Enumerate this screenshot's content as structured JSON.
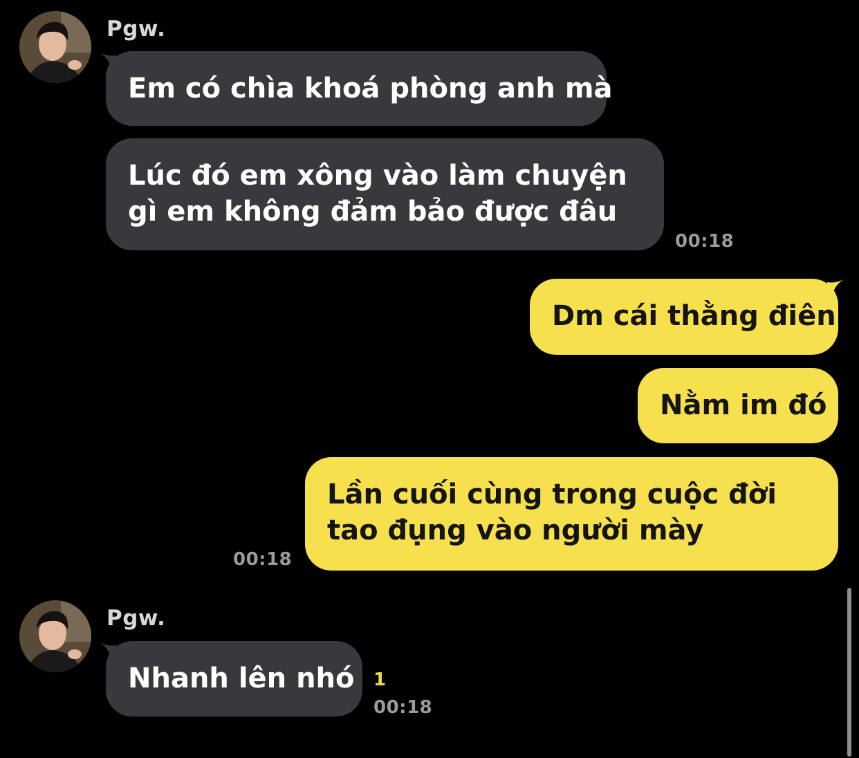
{
  "colors": {
    "background": "#000000",
    "incoming_bubble": "#39393d",
    "outgoing_bubble": "#f7e04e",
    "timestamp": "#9b9b9b",
    "unread": "#f2d94a"
  },
  "groups": [
    {
      "sender": "Pgw.",
      "avatar": "profile-photo",
      "messages": [
        "Em có chìa khoá phòng anh mà",
        "Lúc đó em xông vào làm chuyện gì em không đảm bảo được đâu"
      ],
      "time": "00:18"
    },
    {
      "sender": "me",
      "messages": [
        "Dm cái thằng điên",
        "Nằm im đó",
        "Lần cuối cùng trong cuộc đời tao đụng vào người mày"
      ],
      "time": "00:18"
    },
    {
      "sender": "Pgw.",
      "avatar": "profile-photo",
      "messages": [
        "Nhanh lên nhó"
      ],
      "unread": "1",
      "time": "00:18"
    }
  ]
}
